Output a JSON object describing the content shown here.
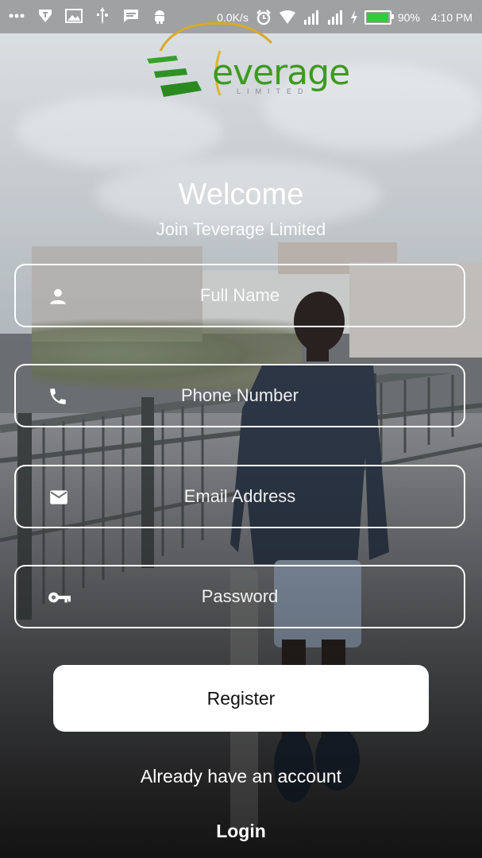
{
  "status_bar": {
    "net_speed": "0.0K/s",
    "battery": "90%",
    "time": "4:10 PM",
    "icons_left": [
      "more-icon",
      "tv-app-icon",
      "image-icon",
      "usb-icon",
      "message-icon",
      "android-icon"
    ],
    "icons_right": [
      "alarm-icon",
      "wifi-icon",
      "signal-icon",
      "signal-icon",
      "charging-icon",
      "battery-icon"
    ]
  },
  "logo": {
    "word": "everage",
    "tagline": "LIMITED",
    "color": "#3e9a1f"
  },
  "header": {
    "title": "Welcome",
    "subtitle": "Join Teverage Limited"
  },
  "form": {
    "full_name": {
      "placeholder": "Full Name",
      "icon": "person-icon"
    },
    "phone": {
      "placeholder": "Phone Number",
      "icon": "phone-icon"
    },
    "email": {
      "placeholder": "Email Address",
      "icon": "email-icon"
    },
    "password": {
      "placeholder": "Password",
      "icon": "key-icon"
    },
    "register_label": "Register"
  },
  "footer": {
    "already_text": "Already have an account",
    "login_label": "Login"
  }
}
